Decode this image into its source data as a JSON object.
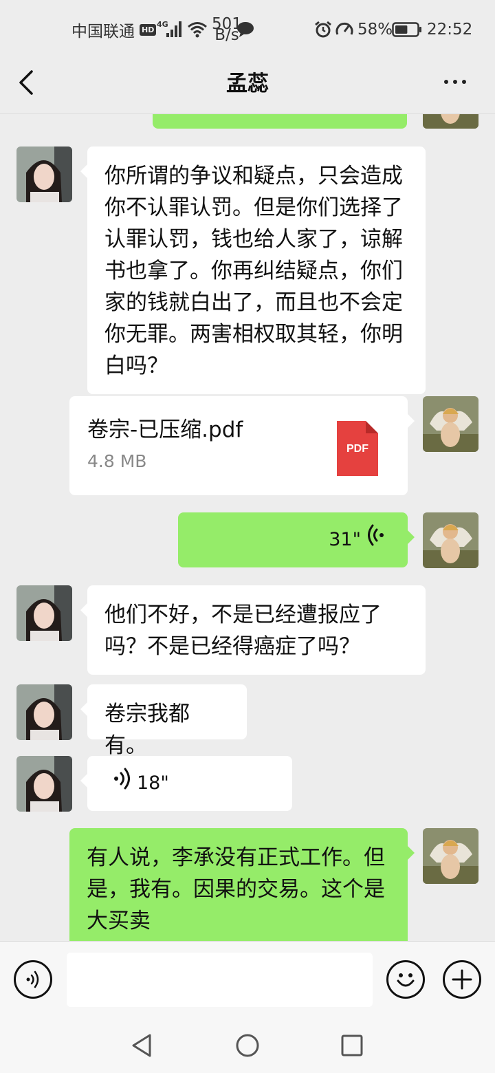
{
  "status_bar": {
    "carrier": "中国联通",
    "hd": "HD",
    "network": "4G",
    "net_speed_value": "501",
    "net_speed_unit": "B/s",
    "battery_percent": "58%",
    "battery_level": 0.58,
    "time": "22:52"
  },
  "header": {
    "title": "孟蕊",
    "icons": [
      "back-icon",
      "more-icon"
    ]
  },
  "messages": [
    {
      "id": "m0",
      "from": "me",
      "type": "text",
      "text": ""
    },
    {
      "id": "m1",
      "from": "other",
      "type": "text",
      "text": "你所谓的争议和疑点，只会造成你不认罪认罚。但是你们选择了认罪认罚，钱也给人家了，谅解书也拿了。你再纠结疑点，你们家的钱就白出了，而且也不会定你无罪。两害相权取其轻，你明白吗？"
    },
    {
      "id": "m2",
      "from": "me",
      "type": "file",
      "file_name": "卷宗-已压缩.pdf",
      "file_size": "4.8 MB",
      "file_icon": "PDF"
    },
    {
      "id": "m3",
      "from": "me",
      "type": "voice",
      "duration": "31\""
    },
    {
      "id": "m4",
      "from": "other",
      "type": "text",
      "text": "他们不好，不是已经遭报应了吗？不是已经得癌症了吗？"
    },
    {
      "id": "m5",
      "from": "other",
      "type": "text",
      "text": "卷宗我都有。"
    },
    {
      "id": "m6",
      "from": "other",
      "type": "voice",
      "duration": "18\""
    },
    {
      "id": "m7",
      "from": "me",
      "type": "text",
      "text": "有人说，李承没有正式工作。但是，我有。因果的交易。这个是大买卖"
    }
  ],
  "input_bar": {
    "icons": [
      "voice-input-icon",
      "emoji-icon",
      "add-icon"
    ],
    "placeholder": ""
  },
  "system_nav": {
    "icons": [
      "nav-back-icon",
      "nav-home-icon",
      "nav-recents-icon"
    ]
  },
  "colors": {
    "background": "#ededed",
    "bubble_out": "#95ec69",
    "bubble_in": "#ffffff",
    "pdf_red": "#e5413f"
  }
}
